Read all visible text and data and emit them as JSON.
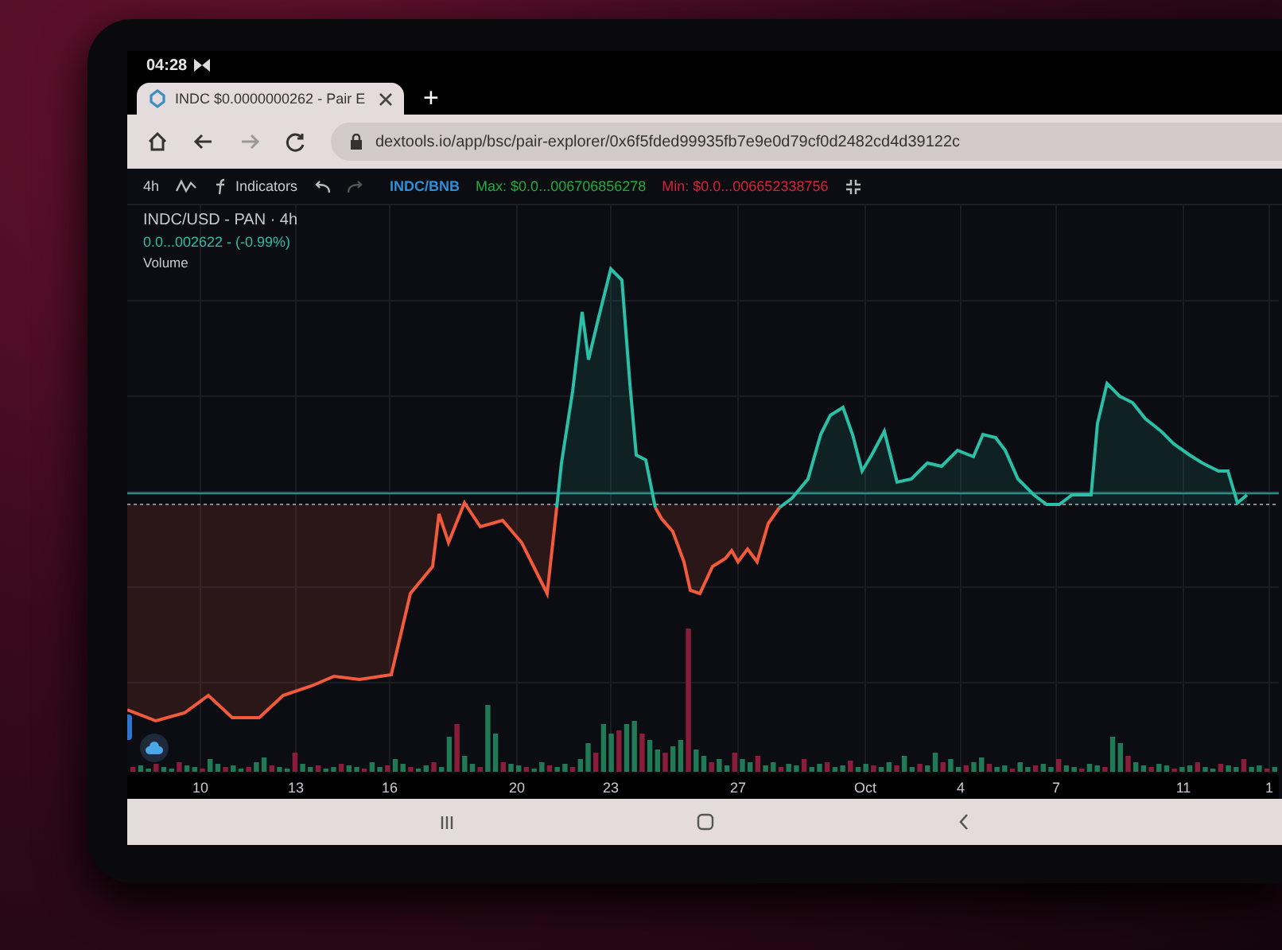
{
  "status_bar": {
    "time": "04:28"
  },
  "browser": {
    "tabs": [
      {
        "title": "INDC $0.0000000262 - Pair E",
        "selected": true
      }
    ],
    "new_tab": "+",
    "url": "dextools.io/app/bsc/pair-explorer/0x6f5fded99935fb7e9e0d79cf0d2482cd4d39122c"
  },
  "chart_toolbar": {
    "interval": "4h",
    "indicators": "Indicators",
    "pair": "INDC/BNB",
    "max": "Max: $0.0...006706856278",
    "min": "Min: $0.0...006652338756"
  },
  "legend": {
    "symbol": "INDC/USD - PAN · 4h",
    "price": "0.0...002622 - (-0.99%)",
    "volume": "Volume"
  },
  "x_axis": {
    "labels": [
      "10",
      "13",
      "16",
      "20",
      "23",
      "27",
      "Oct",
      "4",
      "7",
      "11",
      "1"
    ]
  }
}
